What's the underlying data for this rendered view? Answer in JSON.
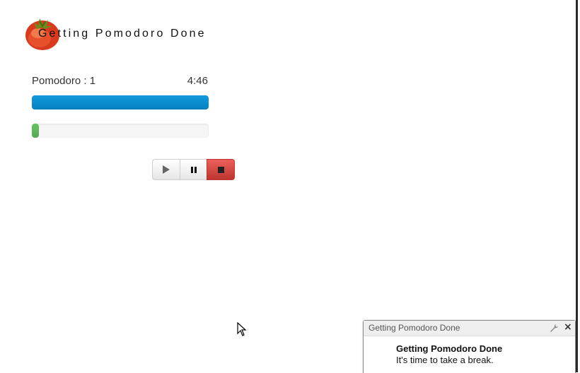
{
  "app": {
    "title": "Getting Pomodoro Done",
    "logo_icon": "tomato-icon"
  },
  "timer": {
    "session_label": "Pomodoro : 1",
    "time_left": "4:46",
    "session_progress": 1.0,
    "elapsed_progress": 0.04,
    "colors": {
      "session_bar": "#0e90d2",
      "elapsed_bar": "#5eb95e"
    }
  },
  "controls": {
    "play_icon": "play-icon",
    "pause_icon": "pause-icon",
    "stop_icon": "stop-icon",
    "stop_color": "#da4f49"
  },
  "notification": {
    "header_title": "Getting Pomodoro Done",
    "settings_icon": "wrench-icon",
    "close_symbol": "×",
    "title": "Getting Pomodoro Done",
    "body": "It's time to take a break."
  }
}
